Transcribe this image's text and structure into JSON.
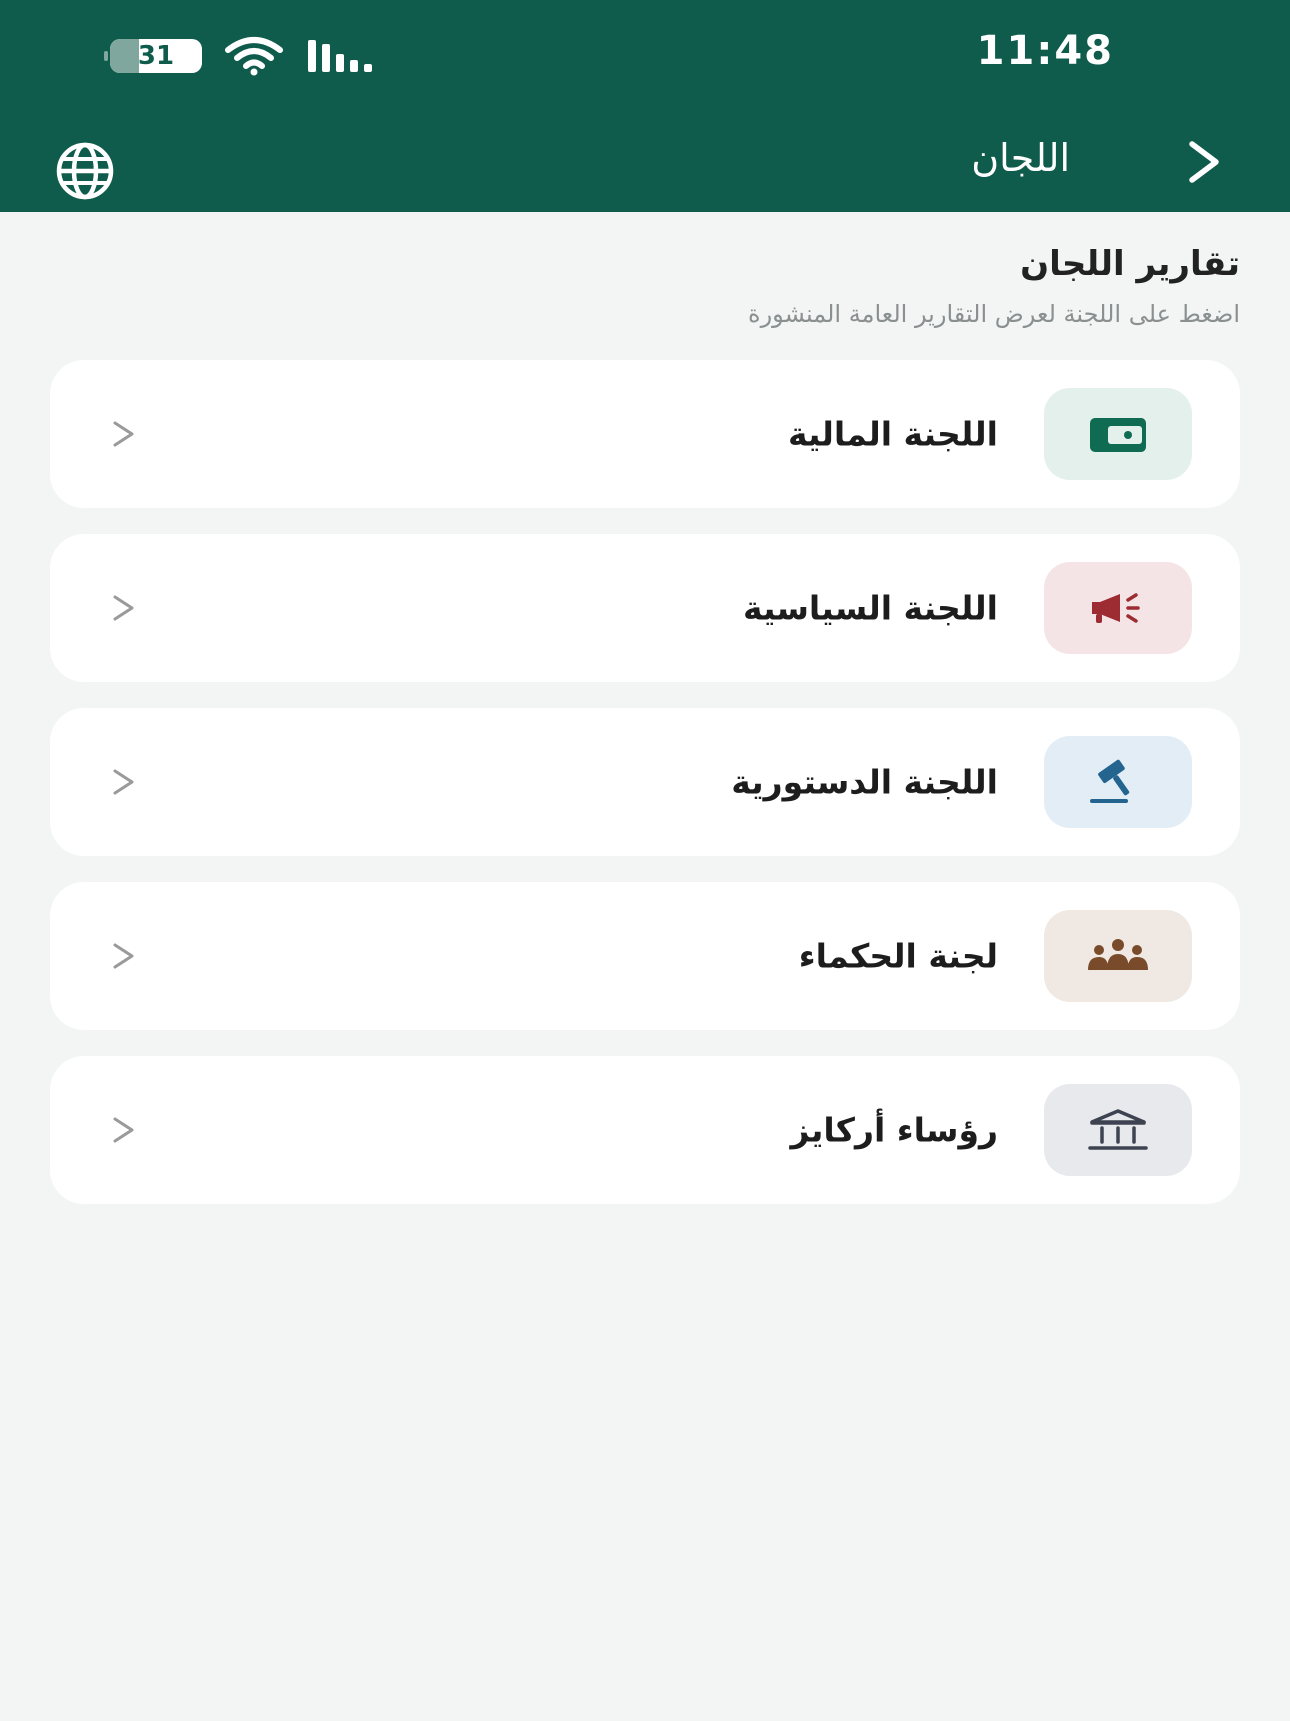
{
  "status_bar": {
    "time": "11:48",
    "battery_level": "31",
    "battery_fraction": 0.31
  },
  "nav": {
    "title": "اللجان"
  },
  "section": {
    "title": "تقارير اللجان",
    "subtitle": "اضغط على اللجنة لعرض التقارير العامة المنشورة"
  },
  "committees": [
    {
      "label": "اللجنة المالية",
      "icon": "wallet-icon",
      "color": "#0f6b52",
      "bg": "#e3f0ec"
    },
    {
      "label": "اللجنة السياسية",
      "icon": "megaphone-icon",
      "color": "#9c2b32",
      "bg": "#f5e4e5"
    },
    {
      "label": "اللجنة الدستورية",
      "icon": "gavel-icon",
      "color": "#23658f",
      "bg": "#e2edf6"
    },
    {
      "label": "لجنة الحكماء",
      "icon": "people-group-icon",
      "color": "#7a4b2a",
      "bg": "#efe8e3"
    },
    {
      "label": "رؤساء أركايز",
      "icon": "institution-icon",
      "color": "#3d4350",
      "bg": "#e8e9ed"
    }
  ],
  "colors": {
    "header_bg": "#0f5c4d",
    "page_bg": "#f3f5f5",
    "card_bg": "#ffffff"
  }
}
